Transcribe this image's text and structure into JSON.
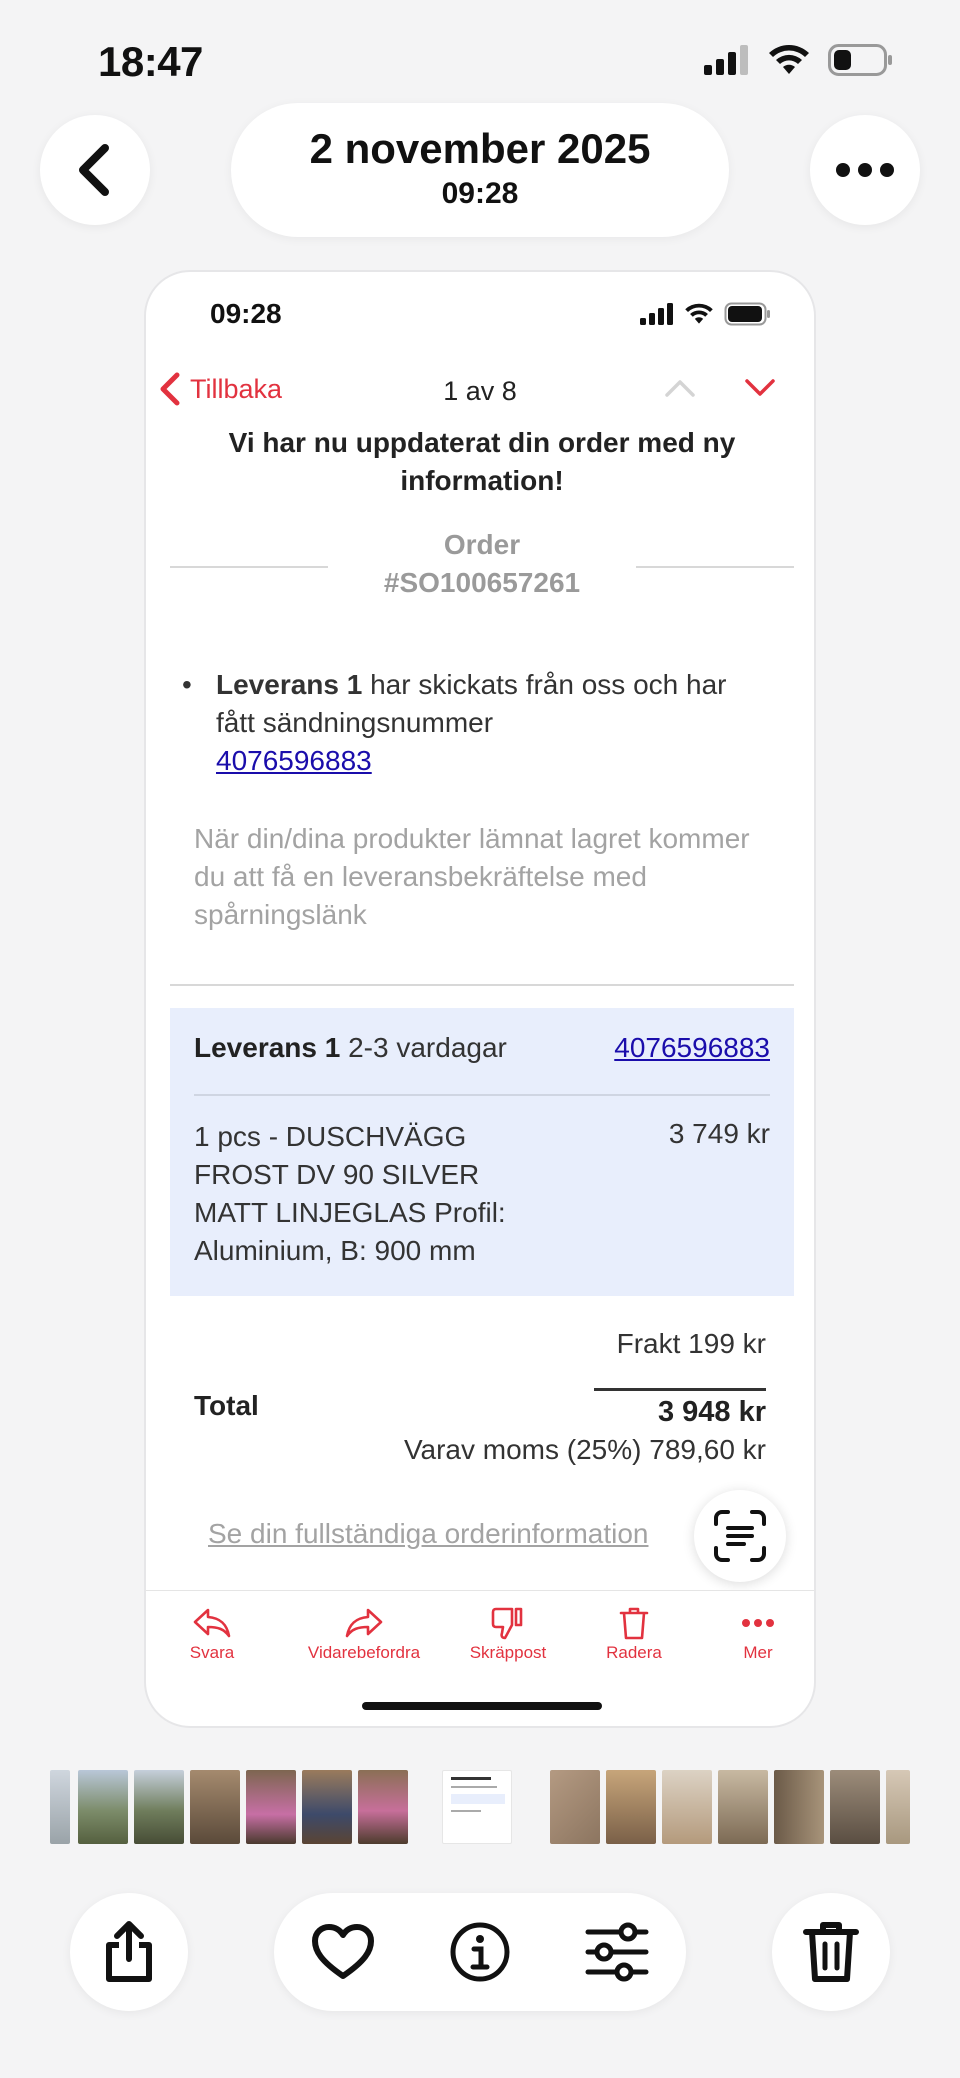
{
  "status_bar": {
    "time": "18:47"
  },
  "header": {
    "date": "2 november 2025",
    "time": "09:28"
  },
  "screenshot": {
    "status_time": "09:28",
    "nav": {
      "back_label": "Tillbaka",
      "count": "1 av 8"
    },
    "headline": "Vi har nu uppdaterat din order med ny information!",
    "order_label": "Order",
    "order_number": "#SO100657261",
    "bullet": {
      "bold": "Leverans 1",
      "text": " har skickats från oss och har fått sändningsnummer",
      "tracking": "4076596883"
    },
    "info_text": "När din/dina produkter lämnat lagret kommer du att få en leveransbekräftelse med spårningslänk",
    "shipment": {
      "title": "Leverans 1",
      "eta": " 2-3 vardagar",
      "tracking": "4076596883",
      "item": "1 pcs - DUSCHVÄGG FROST DV 90 SILVER MATT LINJEGLAS Profil: Aluminium, B: 900 mm",
      "price": "3 749 kr"
    },
    "shipping": "Frakt 199 kr",
    "total_label": "Total",
    "total_value": "3 948 kr",
    "vat": "Varav moms (25%) 789,60 kr",
    "full_order_link": "Se din fullständiga orderinformation",
    "toolbar": [
      {
        "label": "Svara",
        "icon": "reply-icon"
      },
      {
        "label": "Vidarebefordra",
        "icon": "forward-icon"
      },
      {
        "label": "Skräppost",
        "icon": "thumbs-down-icon"
      },
      {
        "label": "Radera",
        "icon": "trash-icon"
      },
      {
        "label": "Mer",
        "icon": "more-dots-icon"
      }
    ]
  },
  "colors": {
    "accent_red": "#e2323f",
    "link_blue": "#1a0dab",
    "shipment_bg": "#e8eefc"
  },
  "bottom_bar": {
    "icons": [
      "share-icon",
      "heart-icon",
      "info-icon",
      "adjust-icon",
      "trash-icon"
    ]
  }
}
